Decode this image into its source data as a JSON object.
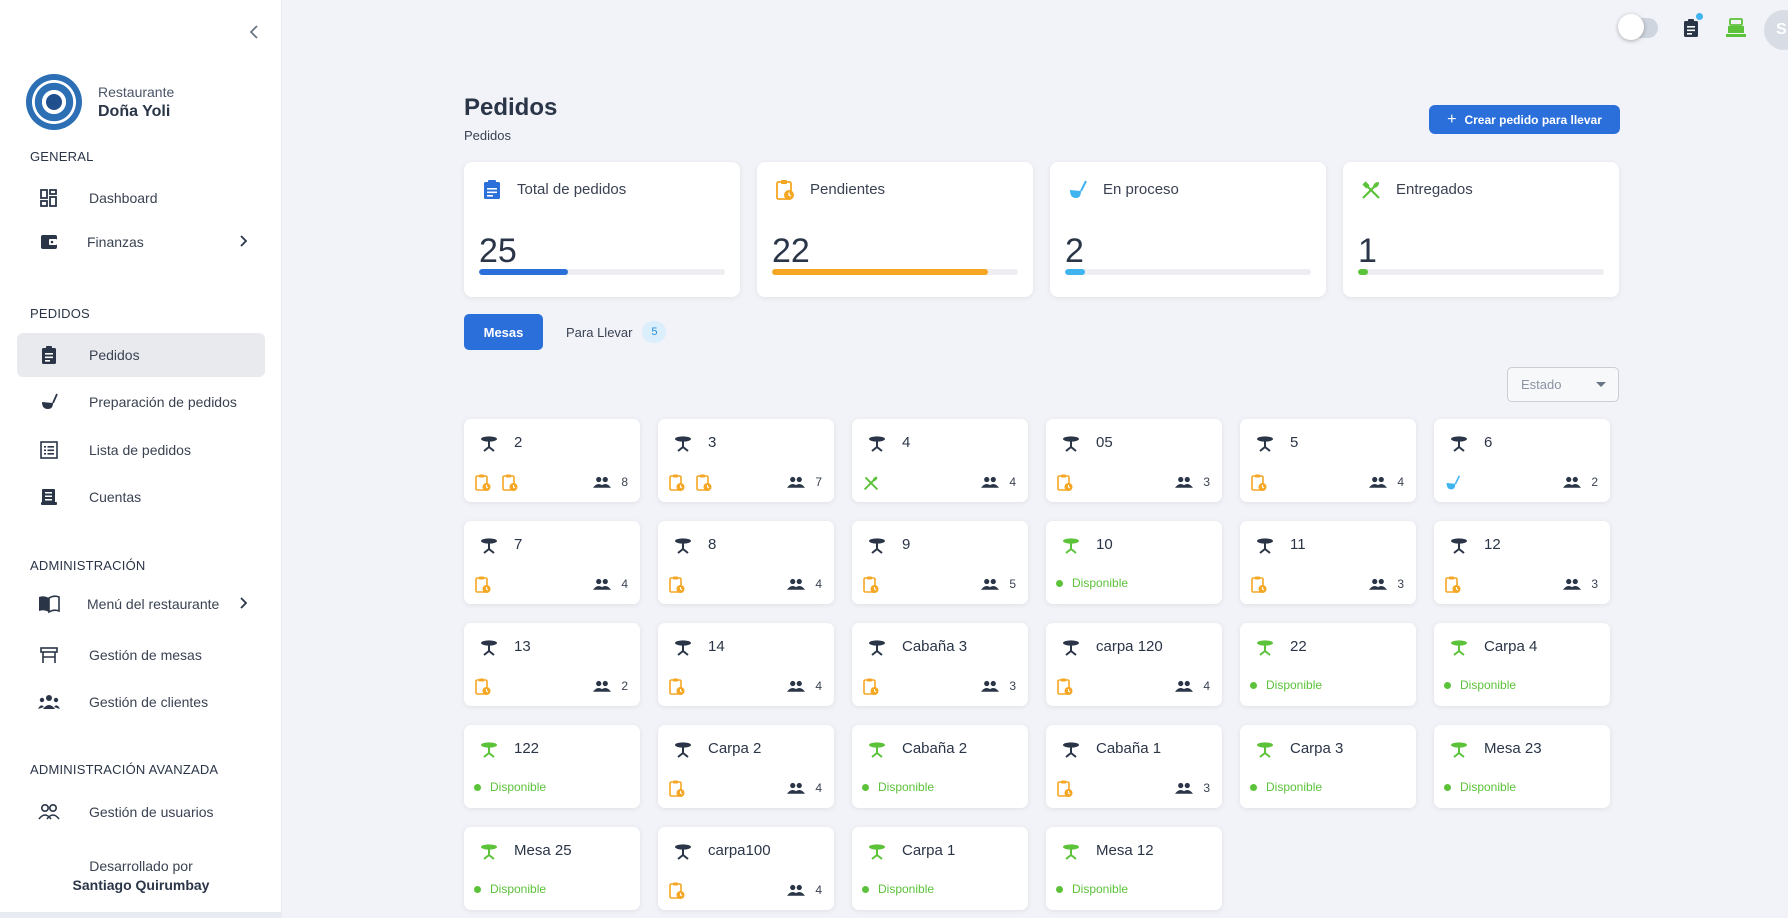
{
  "brand": {
    "subtitle": "Restaurante",
    "name": "Doña Yoli"
  },
  "sidebar": {
    "sections": [
      {
        "label": "GENERAL"
      },
      {
        "label": "PEDIDOS"
      },
      {
        "label": "ADMINISTRACIÓN"
      },
      {
        "label": "ADMINISTRACIÓN AVANZADA"
      }
    ],
    "items": [
      {
        "label": "Dashboard",
        "icon": "dashboard-icon"
      },
      {
        "label": "Finanzas",
        "icon": "wallet-icon"
      },
      {
        "label": "Pedidos",
        "icon": "clipboard-icon",
        "active": true
      },
      {
        "label": "Preparación de pedidos",
        "icon": "ladle-icon"
      },
      {
        "label": "Lista de pedidos",
        "icon": "list-icon"
      },
      {
        "label": "Cuentas",
        "icon": "receipt-icon"
      },
      {
        "label": "Menú del restaurante",
        "icon": "menu-book-icon"
      },
      {
        "label": "Gestión de mesas",
        "icon": "table-icon"
      },
      {
        "label": "Gestión de clientes",
        "icon": "group-icon"
      },
      {
        "label": "Gestión de usuarios",
        "icon": "users-icon"
      }
    ],
    "footer": {
      "line1": "Desarrollado por",
      "author": "Santiago Quirumbay"
    }
  },
  "topbar": {
    "avatar_initial": "S"
  },
  "header": {
    "title": "Pedidos",
    "breadcrumb": "Pedidos",
    "create_button": "Crear pedido para llevar"
  },
  "stats": [
    {
      "label": "Total de pedidos",
      "value": "25",
      "progress": 0.36,
      "color": "#2b6fdb",
      "icon": "clipboard-icon"
    },
    {
      "label": "Pendientes",
      "value": "22",
      "progress": 0.88,
      "color": "#f5a623",
      "icon": "pending-clipboard-icon"
    },
    {
      "label": "En proceso",
      "value": "2",
      "progress": 0.08,
      "color": "#3fb4ef",
      "icon": "ladle-icon"
    },
    {
      "label": "Entregados",
      "value": "1",
      "progress": 0.04,
      "color": "#5cc23a",
      "icon": "utensils-icon"
    }
  ],
  "tabs": {
    "mesas": "Mesas",
    "para_llevar": "Para Llevar",
    "para_llevar_count": "5"
  },
  "filter": {
    "estado_placeholder": "Estado"
  },
  "colors": {
    "occupied": "#2a3547",
    "available": "#5cc23a",
    "pending": "#f5a623",
    "process": "#3fb4ef"
  },
  "tables": [
    {
      "name": "2",
      "status": "pending",
      "orders": [
        "pending",
        "pending"
      ],
      "guests": "8"
    },
    {
      "name": "3",
      "status": "pending",
      "orders": [
        "pending",
        "pending"
      ],
      "guests": "7"
    },
    {
      "name": "4",
      "status": "delivered",
      "orders": [
        "delivered"
      ],
      "guests": "4"
    },
    {
      "name": "05",
      "status": "pending",
      "orders": [
        "pending"
      ],
      "guests": "3"
    },
    {
      "name": "5",
      "status": "pending",
      "orders": [
        "pending"
      ],
      "guests": "4"
    },
    {
      "name": "6",
      "status": "process",
      "orders": [
        "process"
      ],
      "guests": "2"
    },
    {
      "name": "7",
      "status": "pending",
      "orders": [
        "pending"
      ],
      "guests": "4"
    },
    {
      "name": "8",
      "status": "pending",
      "orders": [
        "pending"
      ],
      "guests": "4"
    },
    {
      "name": "9",
      "status": "pending",
      "orders": [
        "pending"
      ],
      "guests": "5"
    },
    {
      "name": "10",
      "status": "available",
      "label": "Disponible"
    },
    {
      "name": "11",
      "status": "pending",
      "orders": [
        "pending"
      ],
      "guests": "3"
    },
    {
      "name": "12",
      "status": "pending",
      "orders": [
        "pending"
      ],
      "guests": "3"
    },
    {
      "name": "13",
      "status": "pending",
      "orders": [
        "pending"
      ],
      "guests": "2"
    },
    {
      "name": "14",
      "status": "pending",
      "orders": [
        "pending"
      ],
      "guests": "4"
    },
    {
      "name": "Cabaña 3",
      "status": "pending",
      "orders": [
        "pending"
      ],
      "guests": "3"
    },
    {
      "name": "carpa 120",
      "status": "pending",
      "orders": [
        "pending"
      ],
      "guests": "4"
    },
    {
      "name": "22",
      "status": "available",
      "label": "Disponible"
    },
    {
      "name": "Carpa 4",
      "status": "available",
      "label": "Disponible"
    },
    {
      "name": "122",
      "status": "available",
      "label": "Disponible"
    },
    {
      "name": "Carpa 2",
      "status": "pending",
      "orders": [
        "pending"
      ],
      "guests": "4"
    },
    {
      "name": "Cabaña 2",
      "status": "available",
      "label": "Disponible"
    },
    {
      "name": "Cabaña 1",
      "status": "pending",
      "orders": [
        "pending"
      ],
      "guests": "3"
    },
    {
      "name": "Carpa 3",
      "status": "available",
      "label": "Disponible"
    },
    {
      "name": "Mesa 23",
      "status": "available",
      "label": "Disponible"
    },
    {
      "name": "Mesa 25",
      "status": "available",
      "label": "Disponible"
    },
    {
      "name": "carpa100",
      "status": "pending",
      "orders": [
        "pending"
      ],
      "guests": "4"
    },
    {
      "name": "Carpa 1",
      "status": "available",
      "label": "Disponible"
    },
    {
      "name": "Mesa 12",
      "status": "available",
      "label": "Disponible"
    }
  ]
}
